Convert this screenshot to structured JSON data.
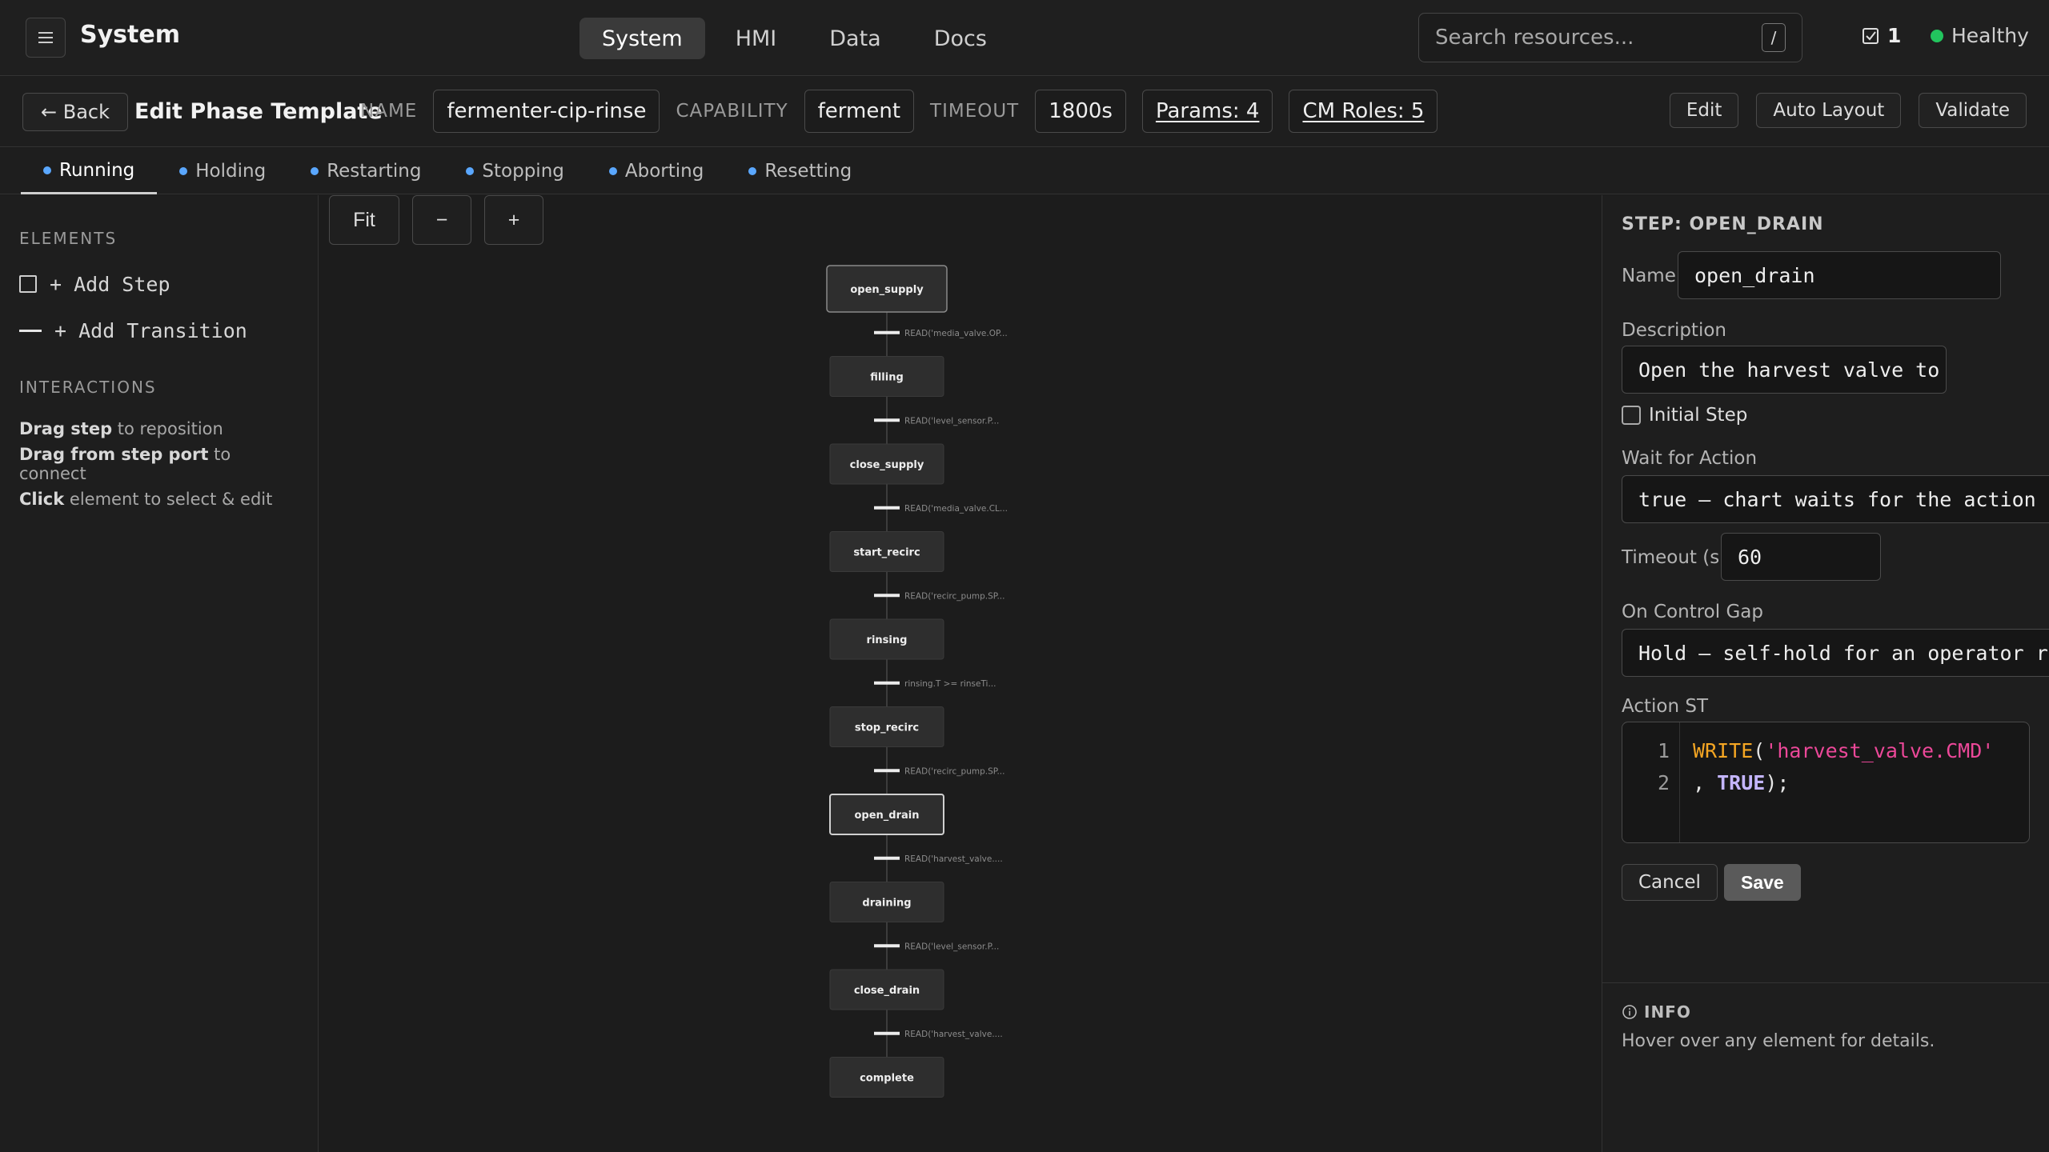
{
  "app": {
    "title": "System"
  },
  "topnav": {
    "items": [
      "System",
      "HMI",
      "Data",
      "Docs"
    ],
    "active": 0
  },
  "search": {
    "placeholder": "Search resources...",
    "shortcut": "/"
  },
  "tasks": {
    "count": "1"
  },
  "status": {
    "label": "Healthy",
    "color": "#22c55e"
  },
  "editor": {
    "back_label": "← Back",
    "title": "Edit Phase Template",
    "name_label": "NAME",
    "name_value": "fermenter-cip-rinse",
    "capability_label": "CAPABILITY",
    "capability_value": "ferment",
    "timeout_label": "TIMEOUT",
    "timeout_value": "1800s",
    "params_label": "Params: 4",
    "cm_roles_label": "CM Roles: 5",
    "actions": [
      "Edit",
      "Auto Layout",
      "Validate"
    ]
  },
  "states": {
    "tabs": [
      "Running",
      "Holding",
      "Restarting",
      "Stopping",
      "Aborting",
      "Resetting"
    ],
    "active": 0,
    "dot_color": "#5aa7ff"
  },
  "elements_panel": {
    "heading": "ELEMENTS",
    "add_step": "+ Add Step",
    "add_transition": "+ Add Transition",
    "interactions_heading": "INTERACTIONS",
    "hints": [
      {
        "bold": "Drag step",
        "rest": " to reposition"
      },
      {
        "bold": "Drag from step port",
        "rest": " to connect"
      },
      {
        "bold": "Click",
        "rest": " element to select & edit"
      }
    ]
  },
  "canvas": {
    "zoom_buttons": [
      "Fit",
      "−",
      "+"
    ],
    "steps": [
      "open_supply",
      "filling",
      "close_supply",
      "start_recirc",
      "rinsing",
      "stop_recirc",
      "open_drain",
      "draining",
      "close_drain",
      "complete"
    ],
    "initial_step": "open_supply",
    "selected_step": "open_drain",
    "transitions": [
      "READ('media_valve.OP...",
      "READ('level_sensor.P...",
      "READ('media_valve.CL...",
      "READ('recirc_pump.SP...",
      "rinsing.T >= rinseTi...",
      "READ('recirc_pump.SP...",
      "READ('harvest_valve....",
      "READ('level_sensor.P...",
      "READ('harvest_valve...."
    ]
  },
  "step_editor": {
    "title": "STEP: OPEN_DRAIN",
    "name_label": "Name",
    "name_value": "open_drain",
    "description_label": "Description",
    "description_value": "Open the harvest valve to",
    "initial_step_label": "Initial Step",
    "initial_step_checked": false,
    "wait_label": "Wait for Action",
    "wait_value": "true — chart waits for the action to",
    "timeout_label": "Timeout (s)",
    "timeout_value": "60",
    "gap_label": "On Control Gap",
    "gap_value": "Hold — self-hold for an operator rul",
    "action_label": "Action ST",
    "code_lines": [
      [
        {
          "t": "WRITE",
          "c": "fn"
        },
        {
          "t": "(",
          "c": "p"
        },
        {
          "t": "'harvest_valve.CMD'",
          "c": "str"
        }
      ],
      [
        {
          "t": ", ",
          "c": "p"
        },
        {
          "t": "TRUE",
          "c": "kw"
        },
        {
          "t": ");",
          "c": "p"
        }
      ]
    ],
    "cancel_label": "Cancel",
    "save_label": "Save"
  },
  "info": {
    "heading": "INFO",
    "text": "Hover over any element for details."
  }
}
